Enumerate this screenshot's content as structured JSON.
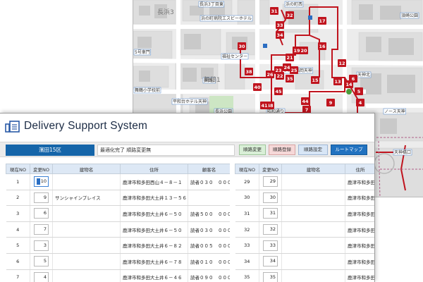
{
  "map": {
    "labels": [
      {
        "text": "長浜3丁目東"
      },
      {
        "text": "浜の町西"
      },
      {
        "text": "浜の町病院エスビーホテル"
      },
      {
        "text": "5号車門"
      },
      {
        "text": "福祉センター"
      },
      {
        "text": "ロイヤル福岡天神"
      },
      {
        "text": "舞鶴1"
      },
      {
        "text": "舞鶴小学校前"
      },
      {
        "text": "平和台ホテル天神"
      },
      {
        "text": "長浜公園"
      },
      {
        "text": "天神北"
      },
      {
        "text": "ノース天神"
      },
      {
        "text": "天神橋口"
      },
      {
        "text": "昭和通り"
      },
      {
        "text": "須崎公園"
      }
    ],
    "area_labels": [
      {
        "text": "長浜3"
      },
      {
        "text": "舞鶴1"
      }
    ],
    "pins": [
      "31",
      "32",
      "17",
      "33",
      "34",
      "30",
      "16",
      "20",
      "19",
      "21",
      "12",
      "24",
      "23",
      "25",
      "26",
      "38",
      "22",
      "35",
      "15",
      "13",
      "40",
      "14",
      "44",
      "48",
      "7",
      "6",
      "9",
      "5",
      "4",
      "41",
      "45"
    ],
    "colors": {
      "route": "#c0141e",
      "pin": "#c0141e",
      "park": "#cde6c4",
      "road": "#ffffff",
      "block": "#e0e0e0"
    }
  },
  "app": {
    "title": "Delivery Support System",
    "logo_icon": "document-stack-icon",
    "route_name": "濱田15区",
    "status_text": "最適化完了 順路変更無",
    "buttons": {
      "order_change": "順路変更",
      "order_register": "順路登録",
      "order_settings": "順路設定",
      "route_map": "ルートマップ"
    },
    "colors": {
      "primary": "#1565a9",
      "header_bg": "#dde8f5"
    }
  },
  "left_table": {
    "columns": [
      "現在NO",
      "変更NO",
      "建物名",
      "住所",
      "顧客名"
    ],
    "rows": [
      {
        "cur": "1",
        "chg": "10",
        "bld": "",
        "adr": "鹿津市和多田西山４－８－１",
        "cus": "読者０３０　０００",
        "focused": true
      },
      {
        "cur": "2",
        "chg": "9",
        "bld": "サンシャインプレイス",
        "adr": "鹿津市和多田大土井１３－５６",
        "cus": ""
      },
      {
        "cur": "3",
        "chg": "6",
        "bld": "",
        "adr": "鹿津市和多田大土井６－５０",
        "cus": "読者５００　０００"
      },
      {
        "cur": "4",
        "chg": "7",
        "bld": "",
        "adr": "鹿津市和多田大土井６－５０",
        "cus": "読者０３０　０００"
      },
      {
        "cur": "5",
        "chg": "3",
        "bld": "",
        "adr": "鹿津市和多田大土井６－８２",
        "cus": "読者００５　０００"
      },
      {
        "cur": "6",
        "chg": "5",
        "bld": "",
        "adr": "鹿津市和多田大土井６－７８",
        "cus": "読者０１０　０００"
      },
      {
        "cur": "7",
        "chg": "4",
        "bld": "",
        "adr": "鹿津市和多田大土井６－４６",
        "cus": "読者０９０　０００"
      }
    ]
  },
  "right_table": {
    "columns": [
      "現在NO",
      "変更NO",
      "建物名",
      "住所"
    ],
    "rows": [
      {
        "cur": "29",
        "chg": "29",
        "bld": "",
        "adr": "鹿津市和多田"
      },
      {
        "cur": "30",
        "chg": "30",
        "bld": "",
        "adr": "鹿津市和多田"
      },
      {
        "cur": "31",
        "chg": "31",
        "bld": "",
        "adr": "鹿津市和多田"
      },
      {
        "cur": "32",
        "chg": "32",
        "bld": "",
        "adr": "鹿津市和多田"
      },
      {
        "cur": "33",
        "chg": "33",
        "bld": "",
        "adr": "鹿津市和多田"
      },
      {
        "cur": "34",
        "chg": "34",
        "bld": "",
        "adr": "鹿津市和多田"
      },
      {
        "cur": "35",
        "chg": "35",
        "bld": "",
        "adr": "鹿津市和多田"
      }
    ]
  }
}
